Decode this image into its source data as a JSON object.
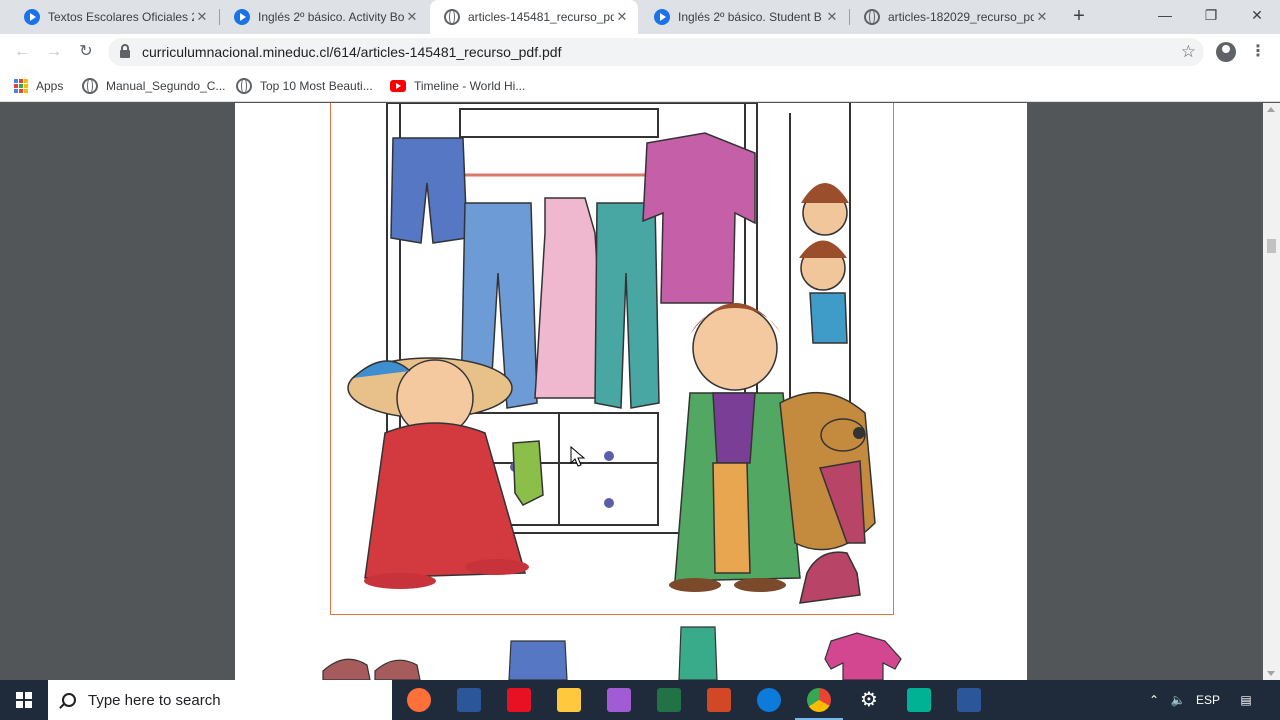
{
  "tabs": [
    {
      "label": "Textos Escolares Oficiales 2",
      "icon": "video-favicon-icon",
      "active": false
    },
    {
      "label": "Inglés 2º básico. Activity Bo",
      "icon": "video-favicon-icon",
      "active": false
    },
    {
      "label": "articles-145481_recurso_pd",
      "icon": "globe-favicon-icon",
      "active": true
    },
    {
      "label": "Inglés 2º básico. Student B",
      "icon": "video-favicon-icon",
      "active": false
    },
    {
      "label": "articles-182029_recurso_pd",
      "icon": "globe-favicon-icon",
      "active": false
    }
  ],
  "toolbar": {
    "url": "curriculumnacional.mineduc.cl/614/articles-145481_recurso_pdf.pdf"
  },
  "bookmarks": [
    {
      "label": "Apps",
      "icon": "apps-grid-icon"
    },
    {
      "label": "Manual_Segundo_C...",
      "icon": "globe-icon"
    },
    {
      "label": "Top 10 Most Beauti...",
      "icon": "globe-icon"
    },
    {
      "label": "Timeline - World Hi...",
      "icon": "youtube-icon"
    }
  ],
  "taskbar": {
    "search_placeholder": "Type here to search",
    "language": "ESP",
    "apps": [
      {
        "name": "firefox-icon",
        "color": "#ff7139"
      },
      {
        "name": "word-icon",
        "color": "#2b579a"
      },
      {
        "name": "gift-app-icon",
        "color": "#e81123"
      },
      {
        "name": "file-explorer-icon",
        "color": "#ffc83d"
      },
      {
        "name": "paint-app-icon",
        "color": "#a05bd5"
      },
      {
        "name": "excel-icon",
        "color": "#217346"
      },
      {
        "name": "powerpoint-icon",
        "color": "#d24726"
      },
      {
        "name": "edge-icon",
        "color": "#0c7bd9"
      },
      {
        "name": "chrome-icon",
        "color": "#4caf50"
      },
      {
        "name": "settings-icon",
        "color": "#ffffff"
      },
      {
        "name": "app-green-icon",
        "color": "#00b294"
      },
      {
        "name": "word-icon",
        "color": "#2b579a"
      }
    ]
  }
}
